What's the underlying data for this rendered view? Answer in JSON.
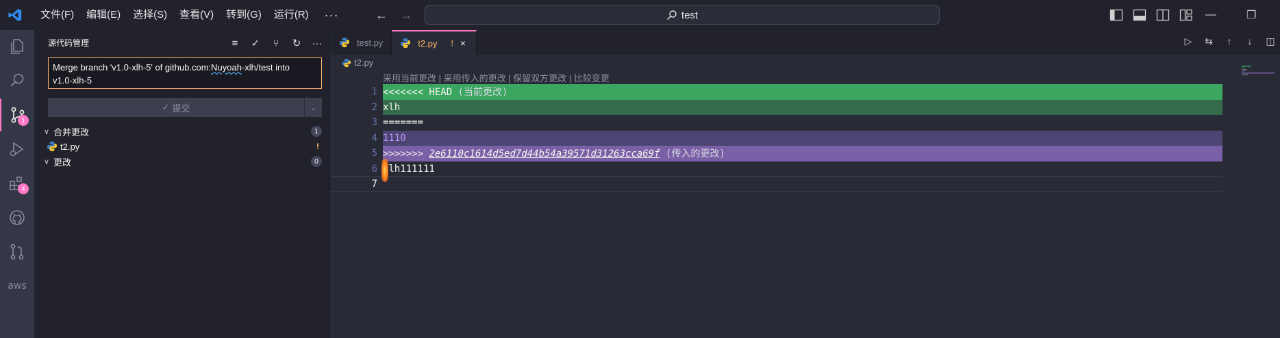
{
  "titlebar": {
    "menu": [
      "文件(F)",
      "编辑(E)",
      "选择(S)",
      "查看(V)",
      "转到(G)",
      "运行(R)"
    ],
    "more": "···",
    "search": "test",
    "colors": {
      "accent": "#ff79c6",
      "vscode_blue": "#2d8cf0"
    }
  },
  "activitybar": {
    "items": [
      {
        "icon": "files-icon"
      },
      {
        "icon": "search-icon"
      },
      {
        "icon": "source-control-icon",
        "badge": "1"
      },
      {
        "icon": "run-debug-icon"
      },
      {
        "icon": "extensions-icon",
        "badge": "4"
      },
      {
        "icon": "github-icon"
      },
      {
        "icon": "pull-request-icon"
      },
      {
        "icon": "aws-icon",
        "label": "aws"
      }
    ]
  },
  "sidebar": {
    "title": "源代码管理",
    "commit_message_line1": "Merge branch 'v1.0-xlh-5' of github.com:",
    "commit_message_squiggle": "Nuyoah",
    "commit_message_line1_rest": "-xlh/test into",
    "commit_message_line2": "v1.0-xlh-5",
    "commit_button": "提交",
    "merge_changes": {
      "label": "合并更改",
      "count": "1"
    },
    "merge_file": {
      "name": "t2.py",
      "status": "!"
    },
    "changes": {
      "label": "更改",
      "count": "0"
    }
  },
  "editor": {
    "tabs": [
      {
        "name": "test.py"
      },
      {
        "name": "t2.py",
        "dirty": "!",
        "close": "×"
      }
    ],
    "breadcrumb": "t2.py",
    "codelens": {
      "accept_current": "采用当前更改",
      "accept_incoming": "采用传入的更改",
      "accept_both": "保留双方更改",
      "compare": "比较变更",
      "sep": " | "
    },
    "lines": [
      {
        "n": "1",
        "text": "<<<<<<< HEAD",
        "note": " (当前更改)"
      },
      {
        "n": "2",
        "text": "xlh"
      },
      {
        "n": "3",
        "text": "======="
      },
      {
        "n": "4",
        "text": "1110"
      },
      {
        "n": "5",
        "text": ">>>>>>> ",
        "hash": "2e6110c1614d5ed7d44b54a39571d31263cca69f",
        "note": " (传入的更改)"
      },
      {
        "n": "6",
        "text": "xlh111111"
      },
      {
        "n": "7",
        "text": ""
      }
    ],
    "colors": {
      "current_header": "#3aa660",
      "current_body": "#346b4a",
      "incoming_header": "#7a60a6",
      "incoming_body": "#4c4472"
    }
  }
}
